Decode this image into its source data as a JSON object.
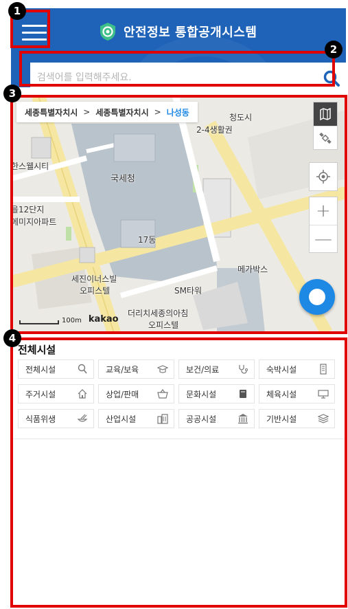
{
  "header": {
    "title": "안전정보 통합공개시스템",
    "menu_icon": "hamburger-menu-icon",
    "logo_icon": "shield-logo-icon",
    "brand_color": "#1e63b8"
  },
  "search": {
    "placeholder": "검색어를 입력해주세요.",
    "value": "",
    "icon": "search-icon",
    "icon_color": "#1e63b8"
  },
  "map": {
    "breadcrumb": [
      "세종특별자치시",
      "세종특별자치시",
      "나성동"
    ],
    "breadcrumb_separator": ">",
    "labels": {
      "l1": "한스웰시티",
      "l2": "국세청",
      "l3": "을12단지",
      "l4": "메미지아파트",
      "l5": "17동",
      "l6": "메가박스",
      "l7": "세진이너스빌",
      "l8": "오피스텔",
      "l9": "SM타워",
      "l10": "더리치세종의아침",
      "l11": "오피스텔",
      "l12": "2-4생활권",
      "l13": "청도시"
    },
    "scale": "100m",
    "provider": "kakao",
    "controls": [
      "map-type-icon",
      "satellite-icon",
      "crosshair-icon",
      "zoom-in-icon",
      "zoom-out-icon"
    ],
    "zoom_in": "+",
    "zoom_out": "—",
    "fab_color": "#1e88e5"
  },
  "facilities": {
    "title": "전체시설",
    "items": [
      {
        "label": "전체시설",
        "icon": "magnifier-icon"
      },
      {
        "label": "교육/보육",
        "icon": "graduation-cap-icon"
      },
      {
        "label": "보건/의료",
        "icon": "stethoscope-icon"
      },
      {
        "label": "숙박시설",
        "icon": "hotel-building-icon"
      },
      {
        "label": "주거시설",
        "icon": "house-icon"
      },
      {
        "label": "상업/판매",
        "icon": "shopping-basket-icon"
      },
      {
        "label": "문화시설",
        "icon": "book-icon"
      },
      {
        "label": "체육시설",
        "icon": "monitor-icon"
      },
      {
        "label": "식품위생",
        "icon": "food-icon"
      },
      {
        "label": "산업시설",
        "icon": "factory-icon"
      },
      {
        "label": "공공시설",
        "icon": "government-building-icon"
      },
      {
        "label": "기반시설",
        "icon": "layers-icon"
      }
    ]
  },
  "annotations": {
    "color": "#e00000",
    "numbers": [
      "1",
      "2",
      "3",
      "4"
    ]
  }
}
